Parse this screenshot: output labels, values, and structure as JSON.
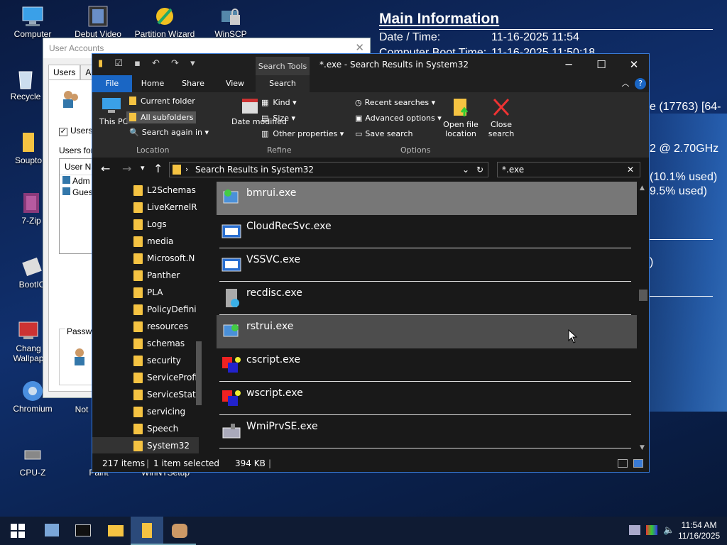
{
  "info": {
    "title": "Main Information",
    "rows": [
      {
        "k": "Date / Time:",
        "v": "11-16-2025 11:54"
      },
      {
        "k": "Computer Boot Time:",
        "v": "11-16-2025 11:50:18"
      }
    ],
    "partial": [
      "e (17763) [64-",
      "2 @ 2.70GHz",
      "(10.1% used)",
      "9.5% used)",
      ")"
    ]
  },
  "desktop_icons": [
    {
      "label": "Computer",
      "icon": "computer-icon"
    },
    {
      "label": "Debut Video",
      "icon": "video-icon"
    },
    {
      "label": "Partition Wizard",
      "icon": "partition-icon"
    },
    {
      "label": "WinSCP",
      "icon": "winscp-icon"
    },
    {
      "label": "Recycle",
      "icon": "recycle-icon"
    },
    {
      "label": "Souptо",
      "icon": "folder-icon"
    },
    {
      "label": "7-Zip",
      "icon": "zip-icon"
    },
    {
      "label": "BootIC",
      "icon": "bootice-icon"
    },
    {
      "label": "Chang Wallpap",
      "icon": "wallpaper-icon"
    },
    {
      "label": "Chromium",
      "icon": "chromium-icon"
    },
    {
      "label": "CPU-Z",
      "icon": "cpuz-icon"
    },
    {
      "label": "Not",
      "icon": "notepad-icon"
    },
    {
      "label": "Paint",
      "icon": "paint-icon"
    },
    {
      "label": "WinNTSetup",
      "icon": "setup-icon"
    }
  ],
  "user_accounts": {
    "title": "User Accounts",
    "tabs": [
      "Users",
      "Ad"
    ],
    "users_checkbox": "Users",
    "users_for": "Users for",
    "col_user": "User Na",
    "users": [
      "Adm",
      "Gues"
    ],
    "password": "Passwo"
  },
  "explorer": {
    "title": "*.exe - Search Results in System32",
    "search_tools": "Search Tools",
    "tabs": [
      "File",
      "Home",
      "Share",
      "View",
      "Search"
    ],
    "ribbon": {
      "this_pc": "This PC",
      "current_folder": "Current folder",
      "all_subfolders": "All subfolders",
      "search_again": "Search again in",
      "date_modified": "Date modified",
      "kind": "Kind",
      "size": "Size",
      "other_props": "Other properties",
      "recent": "Recent searches",
      "advanced": "Advanced options",
      "save": "Save search",
      "open_loc": "Open file location",
      "close_search": "Close search",
      "groups": [
        "Location",
        "Refine",
        "Options"
      ]
    },
    "address": "Search Results in System32",
    "search_value": "*.exe",
    "nav": [
      "L2Schemas",
      "LiveKernelR",
      "Logs",
      "media",
      "Microsoft.N",
      "Panther",
      "PLA",
      "PolicyDefini",
      "resources",
      "schemas",
      "security",
      "ServiceProfi",
      "ServiceState",
      "servicing",
      "Speech",
      "System32"
    ],
    "files": [
      {
        "name": "bmrui.exe",
        "state": "selected"
      },
      {
        "name": "CloudRecSvc.exe",
        "state": ""
      },
      {
        "name": "VSSVC.exe",
        "state": ""
      },
      {
        "name": "recdisc.exe",
        "state": ""
      },
      {
        "name": "rstrui.exe",
        "state": "hover"
      },
      {
        "name": "cscript.exe",
        "state": ""
      },
      {
        "name": "wscript.exe",
        "state": ""
      },
      {
        "name": "WmiPrvSE.exe",
        "state": ""
      }
    ],
    "status": {
      "items": "217 items",
      "selected": "1 item selected",
      "size": "394 KB"
    }
  },
  "taskbar": {
    "time": "11:54 AM",
    "date": "11/16/2025"
  },
  "colors": {
    "accent": "#3a7bd5",
    "folder": "#f5c342",
    "selected": "#777777",
    "hover": "#4d4d4d"
  }
}
